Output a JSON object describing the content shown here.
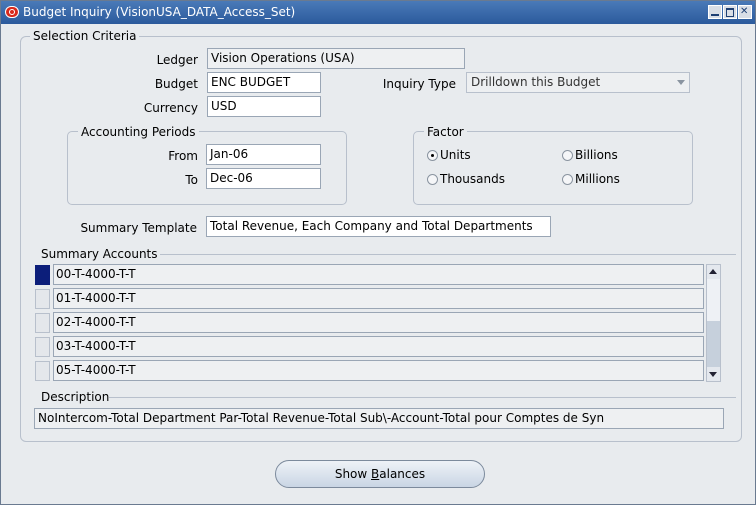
{
  "window": {
    "title": "Budget Inquiry (VisionUSA_DATA_Access_Set)"
  },
  "selection_criteria": {
    "title": "Selection Criteria",
    "ledger_label": "Ledger",
    "ledger_value": "Vision Operations (USA)",
    "budget_label": "Budget",
    "budget_value": "ENC BUDGET",
    "currency_label": "Currency",
    "currency_value": "USD",
    "inquiry_type_label": "Inquiry Type",
    "inquiry_type_value": "Drilldown this Budget"
  },
  "accounting_periods": {
    "title": "Accounting Periods",
    "from_label": "From",
    "from_value": "Jan-06",
    "to_label": "To",
    "to_value": "Dec-06"
  },
  "factor": {
    "title": "Factor",
    "options": [
      {
        "label": "Units",
        "selected": true
      },
      {
        "label": "Billions",
        "selected": false
      },
      {
        "label": "Thousands",
        "selected": false
      },
      {
        "label": "Millions",
        "selected": false
      }
    ]
  },
  "summary_template": {
    "label": "Summary Template",
    "value": "Total Revenue, Each Company and Total Departments"
  },
  "summary_accounts": {
    "title": "Summary Accounts",
    "rows": [
      "00-T-4000-T-T",
      "01-T-4000-T-T",
      "02-T-4000-T-T",
      "03-T-4000-T-T",
      "05-T-4000-T-T"
    ]
  },
  "description": {
    "title": "Description",
    "value": "NoIntercom-Total Department Par-Total  Revenue-Total Sub\\-Account-Total pour Comptes de Syn"
  },
  "actions": {
    "show_balances_prefix": "Show ",
    "show_balances_mnemonic": "B",
    "show_balances_suffix": "alances"
  }
}
